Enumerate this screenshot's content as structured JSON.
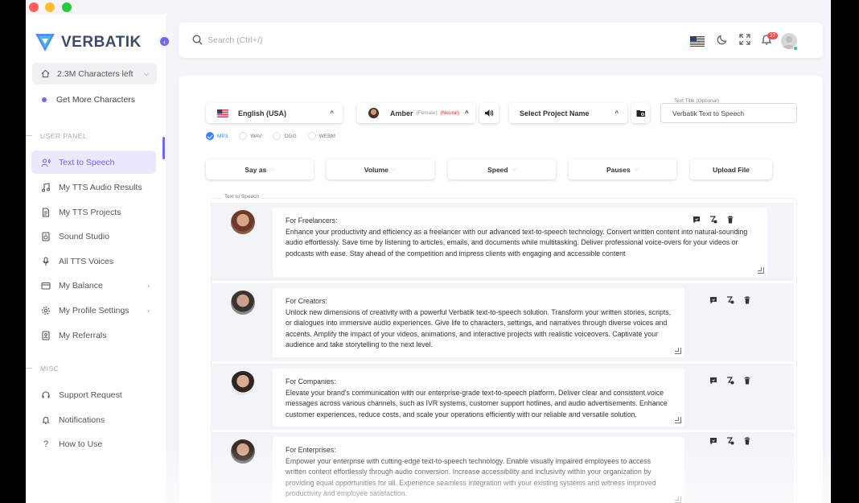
{
  "brand": {
    "name": "VERBATIK",
    "accent": "#7367f0"
  },
  "sidebar": {
    "characters_left": "2.3M Characters left",
    "get_more": "Get More Characters",
    "section_user": "USER PANEL",
    "section_misc": "MISC",
    "user_items": [
      {
        "label": "Text to Speech",
        "icon": "microphone-person-icon",
        "active": true
      },
      {
        "label": "My TTS Audio Results",
        "icon": "music-note-icon"
      },
      {
        "label": "My TTS Projects",
        "icon": "document-icon"
      },
      {
        "label": "Sound Studio",
        "icon": "sound-studio-icon"
      },
      {
        "label": "All TTS Voices",
        "icon": "mic-icon"
      },
      {
        "label": "My Balance",
        "icon": "wallet-icon",
        "has_submenu": true
      },
      {
        "label": "My Profile Settings",
        "icon": "gear-icon",
        "has_submenu": true
      },
      {
        "label": "My Referrals",
        "icon": "referral-icon"
      }
    ],
    "misc_items": [
      {
        "label": "Support Request",
        "icon": "headset-icon"
      },
      {
        "label": "Notifications",
        "icon": "bell-icon"
      },
      {
        "label": "How to Use",
        "icon": "question-icon"
      }
    ]
  },
  "header": {
    "search_placeholder": "Search (Ctrl+/)",
    "notification_count": "27"
  },
  "controls": {
    "language": "English (USA)",
    "voice_name": "Amber",
    "voice_gender": "(Female)",
    "voice_type": "(Neural)",
    "project": "Select Project Name",
    "title_label": "Text Title (Optional)",
    "title_value": "Verbatik Text to Speech",
    "formats": [
      {
        "label": "MP3",
        "selected": true
      },
      {
        "label": "WAV",
        "selected": false
      },
      {
        "label": "OGG",
        "selected": false
      },
      {
        "label": "WEBM",
        "selected": false
      }
    ],
    "options": [
      "Say as",
      "Volume",
      "Speed",
      "Pauses"
    ],
    "upload": "Upload File"
  },
  "tts": {
    "label": "Text to Speech",
    "blocks": [
      {
        "heading": "For Freelancers:",
        "body": "Enhance your productivity and efficiency as a freelancer with our advanced text-to-speech technology. Convert written content into natural-sounding audio effortlessly. Save time by listening to articles, emails, and documents while multitasking. Deliver professional voice-overs for your videos or podcasts with ease. Stay ahead of the competition and impress clients with engaging and accessible content"
      },
      {
        "heading": "For Creators:",
        "body": "Unlock new dimensions of creativity with a powerful Verbatik text-to-speech solution. Transform your written stories, scripts, or dialogues into immersive audio experiences. Give life to characters, settings, and narratives through diverse voices and accents. Amplify the impact of your videos, animations, and interactive projects with realistic voiceovers. Captivate your audience and take storytelling to the next level."
      },
      {
        "heading": "For Companies:",
        "body": "Elevate your brand's communication with our enterprise-grade text-to-speech platform. Deliver clear and consistent voice messages across various channels, such as IVR systems, customer support hotlines, and audio advertisements. Enhance customer experiences, reduce costs, and scale your operations efficiently with our reliable and versatile solution."
      },
      {
        "heading": "For Enterprises:",
        "body": "Empower your enterprise with cutting-edge text-to-speech technology. Enable visually impaired employees to access written content effortlessly through audio conversion. Increase accessibility and inclusivity within your organization by providing equal opportunities for all. Experience seamless integration with your existing systems and witness improved productivity and employee satisfaction."
      }
    ]
  }
}
